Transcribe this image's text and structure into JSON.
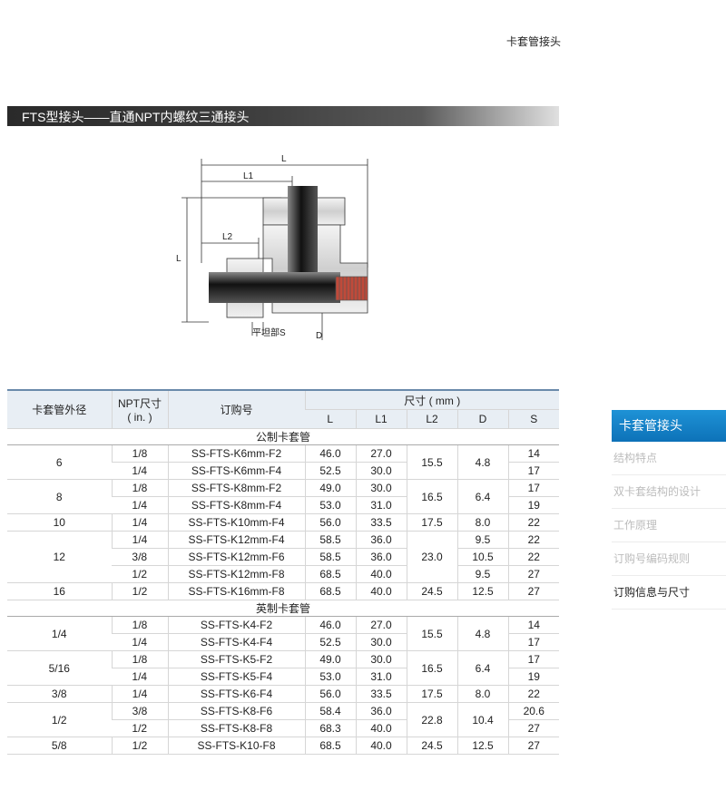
{
  "header": {
    "title": "卡套管接头"
  },
  "banner": {
    "title": "FTS型接头——直通NPT内螺纹三通接头"
  },
  "diagram": {
    "labels": {
      "L_top": "L",
      "L1": "L1",
      "L_side": "L",
      "L2": "L2",
      "flat": "平坦部S",
      "D": "D"
    }
  },
  "table": {
    "headers": {
      "tube_od": "卡套管外径",
      "npt": "NPT尺寸",
      "npt_unit": "( in. )",
      "order": "订购号",
      "dims": "尺寸 ( mm )",
      "L": "L",
      "L1": "L1",
      "L2": "L2",
      "D": "D",
      "S": "S"
    },
    "metric_title": "公制卡套管",
    "imperial_title": "英制卡套管",
    "metric": [
      {
        "od": "6",
        "rows": [
          {
            "npt": "1/8",
            "order": "SS-FTS-K6mm-F2",
            "L": "46.0",
            "L1": "27.0",
            "S": "14"
          },
          {
            "npt": "1/4",
            "order": "SS-FTS-K6mm-F4",
            "L": "52.5",
            "L1": "30.0",
            "S": "17"
          }
        ],
        "L2": "15.5",
        "D": "4.8"
      },
      {
        "od": "8",
        "rows": [
          {
            "npt": "1/8",
            "order": "SS-FTS-K8mm-F2",
            "L": "49.0",
            "L1": "30.0",
            "S": "17"
          },
          {
            "npt": "1/4",
            "order": "SS-FTS-K8mm-F4",
            "L": "53.0",
            "L1": "31.0",
            "S": "19"
          }
        ],
        "L2": "16.5",
        "D": "6.4"
      },
      {
        "od": "10",
        "rows": [
          {
            "npt": "1/4",
            "order": "SS-FTS-K10mm-F4",
            "L": "56.0",
            "L1": "33.5",
            "S": "22"
          }
        ],
        "L2": "17.5",
        "D": "8.0"
      },
      {
        "od": "12",
        "rows": [
          {
            "npt": "1/4",
            "order": "SS-FTS-K12mm-F4",
            "L": "58.5",
            "L1": "36.0",
            "D": "9.5",
            "S": "22"
          },
          {
            "npt": "3/8",
            "order": "SS-FTS-K12mm-F6",
            "L": "58.5",
            "L1": "36.0",
            "D": "10.5",
            "S": "22"
          },
          {
            "npt": "1/2",
            "order": "SS-FTS-K12mm-F8",
            "L": "68.5",
            "L1": "40.0",
            "D": "9.5",
            "S": "27"
          }
        ],
        "L2": "23.0"
      },
      {
        "od": "16",
        "rows": [
          {
            "npt": "1/2",
            "order": "SS-FTS-K16mm-F8",
            "L": "68.5",
            "L1": "40.0",
            "S": "27"
          }
        ],
        "L2": "24.5",
        "D": "12.5"
      }
    ],
    "imperial": [
      {
        "od": "1/4",
        "rows": [
          {
            "npt": "1/8",
            "order": "SS-FTS-K4-F2",
            "L": "46.0",
            "L1": "27.0",
            "S": "14"
          },
          {
            "npt": "1/4",
            "order": "SS-FTS-K4-F4",
            "L": "52.5",
            "L1": "30.0",
            "S": "17"
          }
        ],
        "L2": "15.5",
        "D": "4.8"
      },
      {
        "od": "5/16",
        "rows": [
          {
            "npt": "1/8",
            "order": "SS-FTS-K5-F2",
            "L": "49.0",
            "L1": "30.0",
            "S": "17"
          },
          {
            "npt": "1/4",
            "order": "SS-FTS-K5-F4",
            "L": "53.0",
            "L1": "31.0",
            "S": "19"
          }
        ],
        "L2": "16.5",
        "D": "6.4"
      },
      {
        "od": "3/8",
        "rows": [
          {
            "npt": "1/4",
            "order": "SS-FTS-K6-F4",
            "L": "56.0",
            "L1": "33.5",
            "S": "22"
          }
        ],
        "L2": "17.5",
        "D": "8.0"
      },
      {
        "od": "1/2",
        "rows": [
          {
            "npt": "3/8",
            "order": "SS-FTS-K8-F6",
            "L": "58.4",
            "L1": "36.0",
            "S": "20.6"
          },
          {
            "npt": "1/2",
            "order": "SS-FTS-K8-F8",
            "L": "68.3",
            "L1": "40.0",
            "S": "27"
          }
        ],
        "L2": "22.8",
        "D": "10.4"
      },
      {
        "od": "5/8",
        "rows": [
          {
            "npt": "1/2",
            "order": "SS-FTS-K10-F8",
            "L": "68.5",
            "L1": "40.0",
            "S": "27"
          }
        ],
        "L2": "24.5",
        "D": "12.5"
      }
    ]
  },
  "sidebar": {
    "active": "卡套管接头",
    "items": [
      "结构特点",
      "双卡套结构的设计",
      "工作原理",
      "订购号编码规则",
      "订购信息与尺寸"
    ]
  },
  "colors": {
    "accent": "#0d72b8",
    "banner": "#2a2a2a"
  }
}
